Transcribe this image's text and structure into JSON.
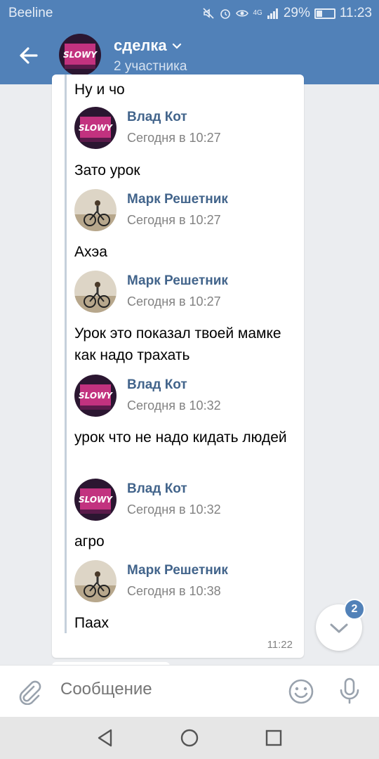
{
  "status_bar": {
    "carrier": "Beeline",
    "battery": "29%",
    "time": "11:23",
    "network": "4G",
    "icons": [
      "mute-icon",
      "alarm-icon",
      "eye-icon",
      "signal-icon",
      "battery-icon"
    ]
  },
  "header": {
    "title": "сделка",
    "subtitle": "2 участника",
    "back_icon": "arrow-left-icon",
    "dropdown_icon": "chevron-down-icon"
  },
  "messages": {
    "partial_text": "Ну и чо",
    "items": [
      {
        "author": "Влад Кот",
        "time": "Сегодня в 10:27",
        "text": "Зато урок",
        "avatar": "slowy-avatar"
      },
      {
        "author": "Марк Решетник",
        "time": "Сегодня в 10:27",
        "text": "Ахэа",
        "avatar": "cyclist-avatar"
      },
      {
        "author": "Марк Решетник",
        "time": "Сегодня в 10:27",
        "text": "Урок это показал твоей мамке как надо трахать",
        "avatar": "cyclist-avatar"
      },
      {
        "author": "Влад Кот",
        "time": "Сегодня в 10:32",
        "text": "урок что не надо кидать людей",
        "avatar": "slowy-avatar"
      },
      {
        "author": "Влад Кот",
        "time": "Сегодня в 10:32",
        "text": "агро",
        "avatar": "slowy-avatar"
      },
      {
        "author": "Марк Решетник",
        "time": "Сегодня в 10:38",
        "text": "Паах",
        "avatar": "cyclist-avatar"
      }
    ],
    "sent_time": "11:22"
  },
  "scroll_button": {
    "badge": "2"
  },
  "composer": {
    "placeholder": "Сообщение"
  },
  "colors": {
    "accent": "#5181b8",
    "name_link": "#42648b",
    "background": "#ebedf0"
  }
}
